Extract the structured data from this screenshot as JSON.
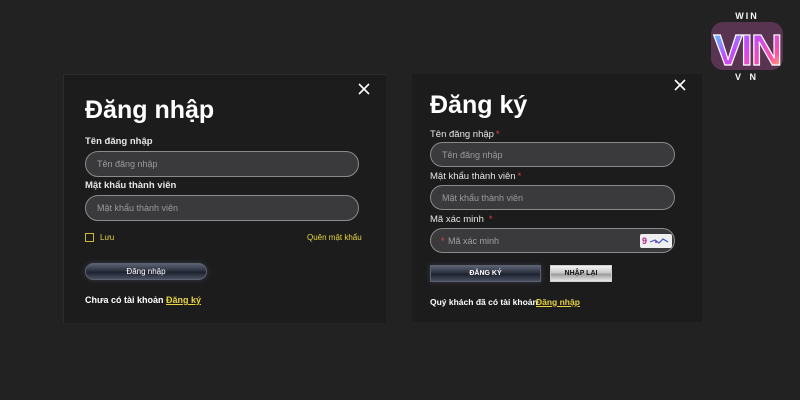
{
  "login": {
    "title": "Đăng nhập",
    "username_label": "Tên đăng nhập",
    "username_placeholder": "Tên đăng nhập",
    "password_label": "Mật khẩu thành viên",
    "password_placeholder": "Mật khẩu thành viên",
    "remember_label": "Lưu",
    "forgot_link": "Quên mật khẩu",
    "submit_label": "Đăng nhập",
    "no_account_text": "Chưa có tài khoản",
    "register_link": "Đăng ký"
  },
  "register": {
    "title": "Đăng ký",
    "username_label": "Tên đăng nhập",
    "username_placeholder": "Tên đăng nhập",
    "password_label": "Mật khẩu thành viên",
    "password_placeholder": "Mật khẩu thành viên",
    "captcha_label": "Mã xác minh",
    "captcha_placeholder": "Mã xác minh",
    "captcha_code": "9",
    "required_mark": "*",
    "submit_label": "ĐĂNG KÝ",
    "reset_label": "NHẬP LẠI",
    "have_account_text": "Quý khách đã có tài khoản",
    "login_link": "Đăng nhập"
  },
  "logo": {
    "top": "WIN",
    "main": "VIN",
    "bottom": "V N"
  },
  "icons": {
    "close": "close-icon",
    "checkbox": "checkbox-unchecked"
  },
  "colors": {
    "background": "#222223",
    "link": "#e8d440",
    "required": "#e0404a",
    "logo_gradient": [
      "#3de0ff",
      "#c24bff",
      "#ff4fa8",
      "#ffd54a"
    ]
  }
}
